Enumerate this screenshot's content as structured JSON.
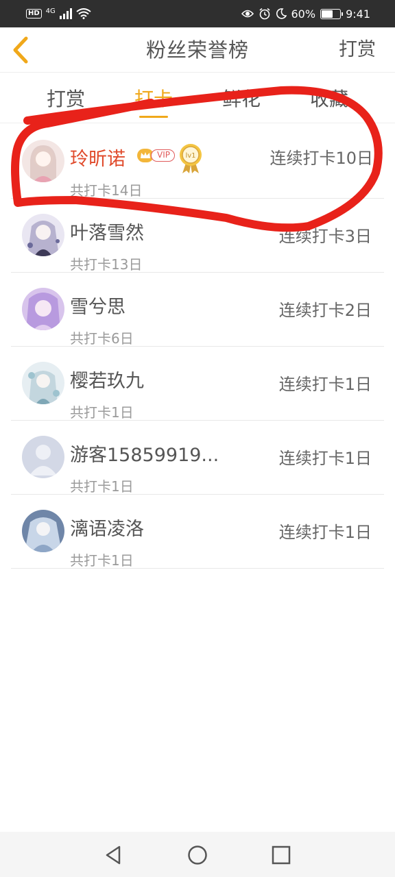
{
  "status_bar": {
    "left_indicators": [
      "HD",
      "4G"
    ],
    "battery_text": "60%",
    "battery_level": 0.6,
    "time": "9:41"
  },
  "header": {
    "title": "粉丝荣誉榜",
    "action_label": "打赏"
  },
  "tabs": [
    {
      "label": "打赏",
      "active": false
    },
    {
      "label": "打卡",
      "active": true
    },
    {
      "label": "鲜花",
      "active": false
    },
    {
      "label": "收藏",
      "active": false
    }
  ],
  "fans": [
    {
      "name": "玲昕诺",
      "total": "共打卡14日",
      "streak": "连续打卡10日",
      "vip_label": "VIP",
      "level_label": "lv1",
      "highlight": true
    },
    {
      "name": "叶落雪然",
      "total": "共打卡13日",
      "streak": "连续打卡3日"
    },
    {
      "name": "雪兮思",
      "total": "共打卡6日",
      "streak": "连续打卡2日"
    },
    {
      "name": "樱若玖九",
      "total": "共打卡1日",
      "streak": "连续打卡1日"
    },
    {
      "name": "游客15859919...",
      "total": "共打卡1日",
      "streak": "连续打卡1日"
    },
    {
      "name": "漓语凌洛",
      "total": "共打卡1日",
      "streak": "连续打卡1日"
    }
  ],
  "colors": {
    "accent": "#f0a81a",
    "highlight_name": "#e04b2c",
    "annotation": "#e8221a"
  },
  "icons": {
    "back": "chevron-left-icon",
    "nav_back": "triangle-back-icon",
    "nav_home": "circle-home-icon",
    "nav_recent": "square-recent-icon"
  }
}
